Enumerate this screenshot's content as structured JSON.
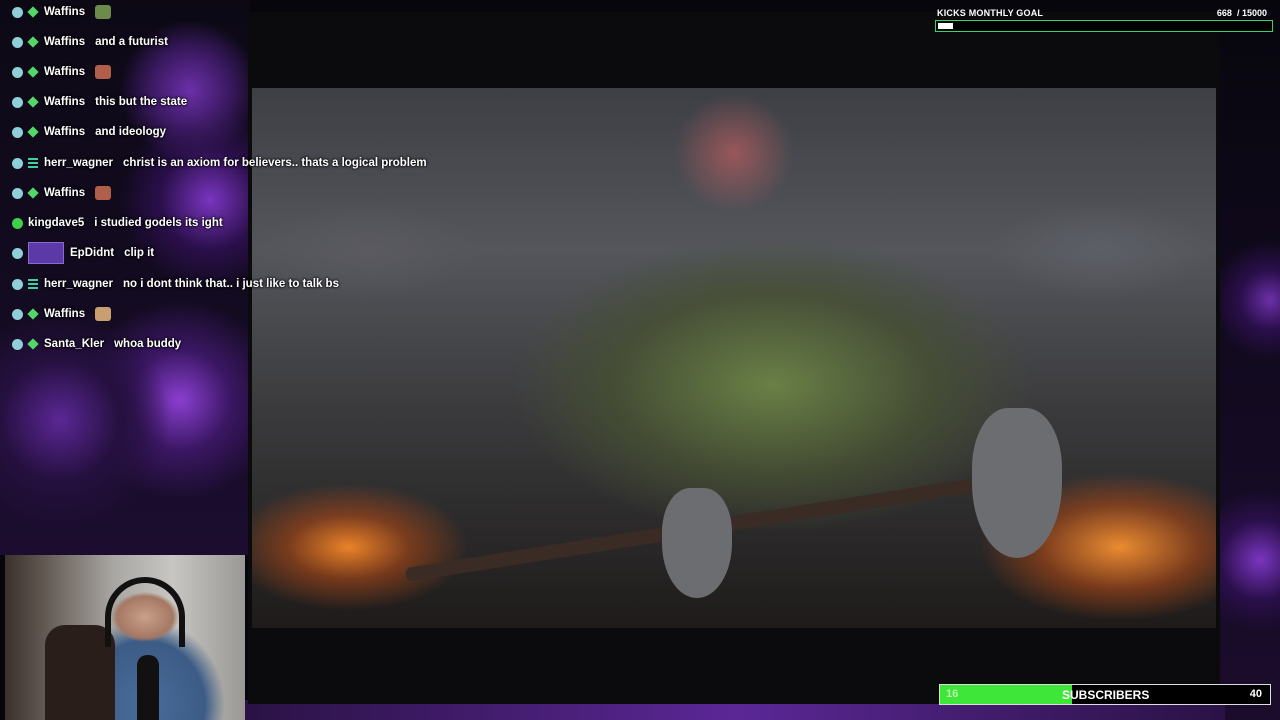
{
  "chat": {
    "messages": [
      {
        "user": "Waffins",
        "text": "",
        "badge": "diamond",
        "user_color": "#ffffff",
        "emote": "turtle"
      },
      {
        "user": "Waffins",
        "text": "and a futurist",
        "badge": "diamond",
        "user_color": "#ffffff"
      },
      {
        "user": "Waffins",
        "text": "",
        "badge": "diamond",
        "user_color": "#ffffff",
        "emote": "face"
      },
      {
        "user": "Waffins",
        "text": "this but the state",
        "badge": "diamond",
        "user_color": "#ffffff"
      },
      {
        "user": "Waffins",
        "text": "and ideology",
        "badge": "diamond",
        "user_color": "#ffffff"
      },
      {
        "user": "herr_wagner",
        "text": "christ is an axiom for believers.. thats a logical problem",
        "badge": "lines",
        "user_color": "#ffffff"
      },
      {
        "user": "Waffins",
        "text": "",
        "badge": "diamond",
        "user_color": "#ffffff",
        "emote": "face"
      },
      {
        "user": "kingdave5",
        "text": "i studied godels its ight",
        "badge": "none",
        "user_color": "#ffffff"
      },
      {
        "user": "EpDidnt",
        "text": "clip it",
        "badge": "avatar",
        "user_color": "#ffffff"
      },
      {
        "user": "herr_wagner",
        "text": "no i dont think that.. i just like to talk bs",
        "badge": "lines",
        "user_color": "#ffffff"
      },
      {
        "user": "Waffins",
        "text": "",
        "badge": "diamond",
        "user_color": "#ffffff",
        "emote": "hand"
      },
      {
        "user": "Santa_Kler",
        "text": "whoa buddy",
        "badge": "diamond",
        "user_color": "#ffffff"
      }
    ]
  },
  "kicks_goal": {
    "label": "KICKS MONTHLY GOAL",
    "current": "668",
    "target": "/ 15000",
    "progress": 0.045
  },
  "subscribers": {
    "current": "16",
    "label": "SUBSCRIBERS",
    "target": "40",
    "progress": 0.4
  },
  "colors": {
    "accent": "#53d769",
    "bar_green": "#3ee63a",
    "background": "#07060d",
    "purple": "#6b2fa8"
  }
}
